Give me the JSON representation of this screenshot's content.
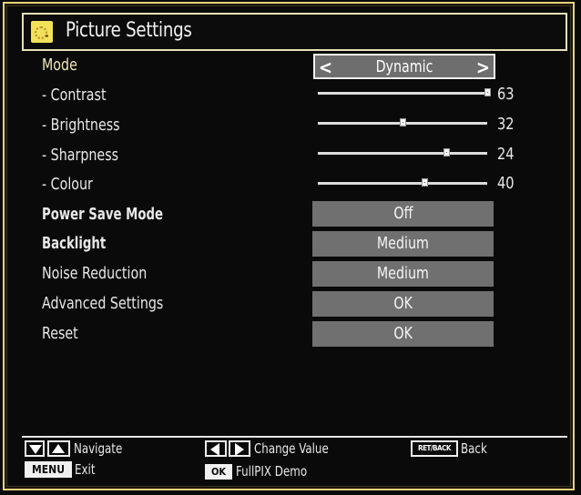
{
  "header": {
    "title": "Picture Settings",
    "icon": "picture-icon"
  },
  "mode": {
    "label": "Mode",
    "value": "Dynamic",
    "prev_arrow": "<",
    "next_arrow": ">"
  },
  "sliders": [
    {
      "label": "- Contrast",
      "value": "63",
      "fraction": 1.0
    },
    {
      "label": "- Brightness",
      "value": "32",
      "fraction": 0.5
    },
    {
      "label": "- Sharpness",
      "value": "24",
      "fraction": 0.76
    },
    {
      "label": "- Colour",
      "value": "40",
      "fraction": 0.63
    }
  ],
  "options": [
    {
      "label": "Power Save Mode",
      "value": "Off"
    },
    {
      "label": "Backlight",
      "value": "Medium"
    },
    {
      "label": "Noise Reduction",
      "value": "Medium"
    },
    {
      "label": "Advanced Settings",
      "value": "OK"
    },
    {
      "label": "Reset",
      "value": "OK"
    }
  ],
  "footer": {
    "navigate": "Navigate",
    "change_value": "Change Value",
    "back_key": "RET/BACK",
    "back": "Back",
    "menu_key": "MENU",
    "exit": "Exit",
    "ok_key": "OK",
    "fullpix": "FullPIX Demo"
  },
  "colors": {
    "frame": "#e6d27a",
    "accent_label": "#f0e6b4",
    "value_box": "#707070"
  }
}
